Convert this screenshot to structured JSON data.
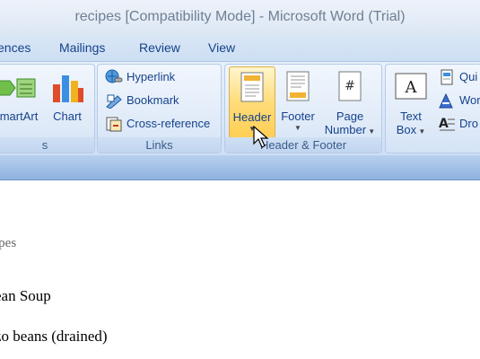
{
  "window": {
    "title": "recipes [Compatibility Mode] - Microsoft Word (Trial)"
  },
  "tabs": [
    "ences",
    "Mailings",
    "Review",
    "View"
  ],
  "ribbon": {
    "illustrations": {
      "buttons": [
        {
          "label": "martArt",
          "icon": "smartart-icon"
        },
        {
          "label": "Chart",
          "icon": "chart-icon"
        }
      ],
      "label": "s"
    },
    "links": {
      "items": [
        {
          "label": "Hyperlink",
          "icon": "hyperlink-icon"
        },
        {
          "label": "Bookmark",
          "icon": "bookmark-icon"
        },
        {
          "label": "Cross-reference",
          "icon": "cross-reference-icon"
        }
      ],
      "label": "Links"
    },
    "header_footer": {
      "buttons": [
        {
          "label": "Header",
          "icon": "header-icon",
          "state": "hover"
        },
        {
          "label": "Footer",
          "icon": "footer-icon"
        },
        {
          "label_line1": "Page",
          "label_line2": "Number",
          "icon": "page-number-icon"
        }
      ],
      "label": "Header & Footer"
    },
    "text": {
      "textbox": {
        "label_line1": "Text",
        "label_line2": "Box",
        "icon": "textbox-icon"
      },
      "items": [
        {
          "label": "Qui",
          "icon": "quickparts-icon"
        },
        {
          "label": "Wor",
          "icon": "wordart-icon"
        },
        {
          "label": "Dro",
          "icon": "dropcap-icon"
        }
      ]
    }
  },
  "document": {
    "lines": [
      "ipes",
      "ean Soup",
      "zo beans (drained)"
    ]
  },
  "colors": {
    "tab_text": "#15428b",
    "hover_fill": "#ffcf55",
    "ribbon_bg": "#dfeaf8"
  }
}
